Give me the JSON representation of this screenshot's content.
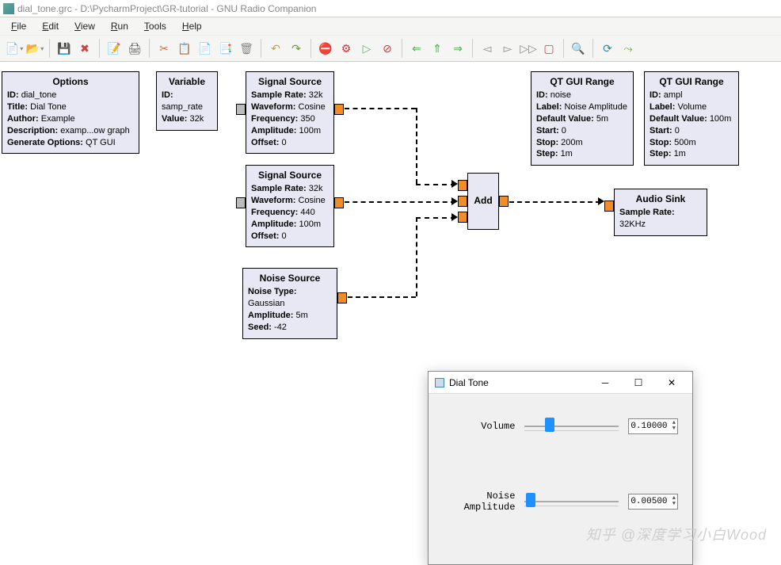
{
  "window": {
    "title": "dial_tone.grc - D:\\PycharmProject\\GR-tutorial - GNU Radio Companion"
  },
  "menubar": [
    "File",
    "Edit",
    "View",
    "Run",
    "Tools",
    "Help"
  ],
  "toolbar_icons": [
    "new",
    "open",
    "save",
    "delete",
    "edit",
    "print",
    "cut",
    "copy",
    "paste",
    "paste-all",
    "trash",
    "undo",
    "redo",
    "stop-record",
    "rec-toggle",
    "play",
    "stop-run",
    "back",
    "up",
    "forward",
    "step-back",
    "step-into",
    "step-fwd",
    "clear",
    "search",
    "reload",
    "reload-all"
  ],
  "blocks": {
    "options": {
      "title": "Options",
      "rows": [
        {
          "k": "ID:",
          "v": "dial_tone"
        },
        {
          "k": "Title:",
          "v": "Dial Tone"
        },
        {
          "k": "Author:",
          "v": "Example"
        },
        {
          "k": "Description:",
          "v": "examp...ow graph"
        },
        {
          "k": "Generate Options:",
          "v": "QT GUI"
        }
      ]
    },
    "variable": {
      "title": "Variable",
      "rows": [
        {
          "k": "ID:",
          "v": "samp_rate"
        },
        {
          "k": "Value:",
          "v": "32k"
        }
      ]
    },
    "sig1": {
      "title": "Signal Source",
      "rows": [
        {
          "k": "Sample Rate:",
          "v": "32k"
        },
        {
          "k": "Waveform:",
          "v": "Cosine"
        },
        {
          "k": "Frequency:",
          "v": "350"
        },
        {
          "k": "Amplitude:",
          "v": "100m"
        },
        {
          "k": "Offset:",
          "v": "0"
        }
      ]
    },
    "sig2": {
      "title": "Signal Source",
      "rows": [
        {
          "k": "Sample Rate:",
          "v": "32k"
        },
        {
          "k": "Waveform:",
          "v": "Cosine"
        },
        {
          "k": "Frequency:",
          "v": "440"
        },
        {
          "k": "Amplitude:",
          "v": "100m"
        },
        {
          "k": "Offset:",
          "v": "0"
        }
      ]
    },
    "noise": {
      "title": "Noise Source",
      "rows": [
        {
          "k": "Noise Type:",
          "v": "Gaussian"
        },
        {
          "k": "Amplitude:",
          "v": "5m"
        },
        {
          "k": "Seed:",
          "v": "-42"
        }
      ]
    },
    "add": {
      "title": "Add"
    },
    "range1": {
      "title": "QT GUI Range",
      "rows": [
        {
          "k": "ID:",
          "v": "noise"
        },
        {
          "k": "Label:",
          "v": "Noise Amplitude"
        },
        {
          "k": "Default Value:",
          "v": "5m"
        },
        {
          "k": "Start:",
          "v": "0"
        },
        {
          "k": "Stop:",
          "v": "200m"
        },
        {
          "k": "Step:",
          "v": "1m"
        }
      ]
    },
    "range2": {
      "title": "QT GUI Range",
      "rows": [
        {
          "k": "ID:",
          "v": "ampl"
        },
        {
          "k": "Label:",
          "v": "Volume"
        },
        {
          "k": "Default Value:",
          "v": "100m"
        },
        {
          "k": "Start:",
          "v": "0"
        },
        {
          "k": "Stop:",
          "v": "500m"
        },
        {
          "k": "Step:",
          "v": "1m"
        }
      ]
    },
    "audio": {
      "title": "Audio Sink",
      "rows": [
        {
          "k": "Sample Rate:",
          "v": "32KHz"
        }
      ]
    }
  },
  "dialog": {
    "title": "Dial Tone",
    "sliders": [
      {
        "label": "Volume",
        "value": "0.10000",
        "thumb_pct": 20
      },
      {
        "label": "Noise Amplitude",
        "value": "0.00500",
        "thumb_pct": 3
      }
    ]
  },
  "watermark": "知乎 @深度学习小白Wood"
}
